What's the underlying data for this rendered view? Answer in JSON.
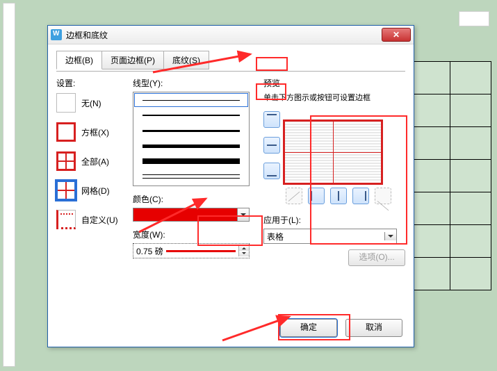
{
  "dialog": {
    "title": "边框和底纹",
    "close_glyph": "✕"
  },
  "tabs": {
    "border": "边框(B)",
    "page_border": "页面边框(P)",
    "shading": "底纹(S)"
  },
  "settings": {
    "label": "设置:",
    "none": "无(N)",
    "box": "方框(X)",
    "all": "全部(A)",
    "grid": "网格(D)",
    "custom": "自定义(U)"
  },
  "style": {
    "line_label": "线型(Y):",
    "color_label": "颜色(C):",
    "width_label": "宽度(W):",
    "width_value": "0.75 磅"
  },
  "preview": {
    "label": "预览",
    "hint": "单击下方图示或按钮可设置边框"
  },
  "apply": {
    "label": "应用于(L):",
    "value": "表格",
    "options_btn": "选项(O)..."
  },
  "buttons": {
    "ok": "确定",
    "cancel": "取消"
  }
}
